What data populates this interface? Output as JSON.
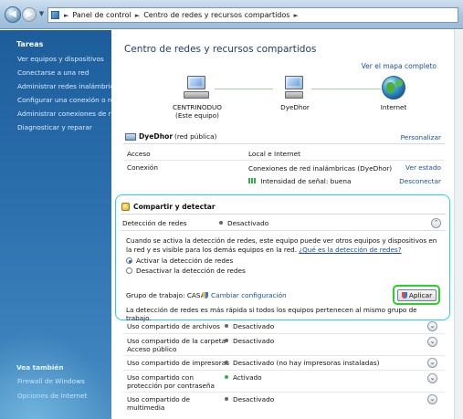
{
  "address": {
    "crumbs": [
      "Panel de control",
      "Centro de redes y recursos compartidos"
    ]
  },
  "sidebar": {
    "tasks_heading": "Tareas",
    "tasks": [
      "Ver equipos y dispositivos",
      "Conectarse a una red",
      "Administrar redes inalámbricas",
      "Configurar una conexión o red",
      "Administrar conexiones de red",
      "Diagnosticar y reparar"
    ],
    "see_also_heading": "Vea también",
    "see_also": [
      "Firewall de Windows",
      "Opciones de Internet"
    ]
  },
  "main": {
    "title": "Centro de redes y recursos compartidos",
    "full_map_link": "Ver el mapa completo",
    "map": {
      "computer_name": "CENTRINODUO",
      "computer_sub": "(Este equipo)",
      "network_name": "DyeDhor",
      "internet_label": "Internet"
    },
    "network": {
      "name": "DyeDhor",
      "type": "(red pública)",
      "customize_link": "Personalizar",
      "access_label": "Acceso",
      "access_value": "Local e Internet",
      "connection_label": "Conexión",
      "connection_value": "Conexiones de red inalámbricas (DyeDhor)",
      "view_status_link": "Ver estado",
      "signal_value": "Intensidad de señal: buena",
      "disconnect_link": "Desconectar"
    },
    "share": {
      "section_title": "Compartir y detectar",
      "discovery_label": "Detección de redes",
      "discovery_status": "Desactivado",
      "description": "Cuando se activa la detección de redes, este equipo puede ver otros equipos y dispositivos en la red y es visible para los demás equipos en la red.",
      "help_link": "¿Qué es la detección de redes?",
      "option_on": "Activar la detección de redes",
      "option_off": "Desactivar la detección de redes",
      "apply_label": "Aplicar",
      "workgroup_label": "Grupo de trabajo: CASA",
      "change_config_link": "Cambiar configuración",
      "tip": "La detección de redes es más rápida si todos los equipos pertenecen al mismo grupo de trabajo."
    },
    "sharing_rows": [
      {
        "label": "Uso compartido de archivos",
        "status": "Desactivado"
      },
      {
        "label": "Uso compartido de la carpeta Acceso público",
        "status": "Desactivado"
      },
      {
        "label": "Uso compartido de impresoras",
        "status": "Desactivado (no hay impresoras instaladas)"
      },
      {
        "label": "Uso compartido con protección por contraseña",
        "status": "Activado"
      },
      {
        "label": "Uso compartido de multimedia",
        "status": "Desactivado"
      }
    ]
  },
  "colors": {
    "sidebar_top": "#1d5d9c",
    "highlight_box": "#26d3e6",
    "apply_highlight": "#25d12a",
    "link": "#1a4fa0"
  }
}
